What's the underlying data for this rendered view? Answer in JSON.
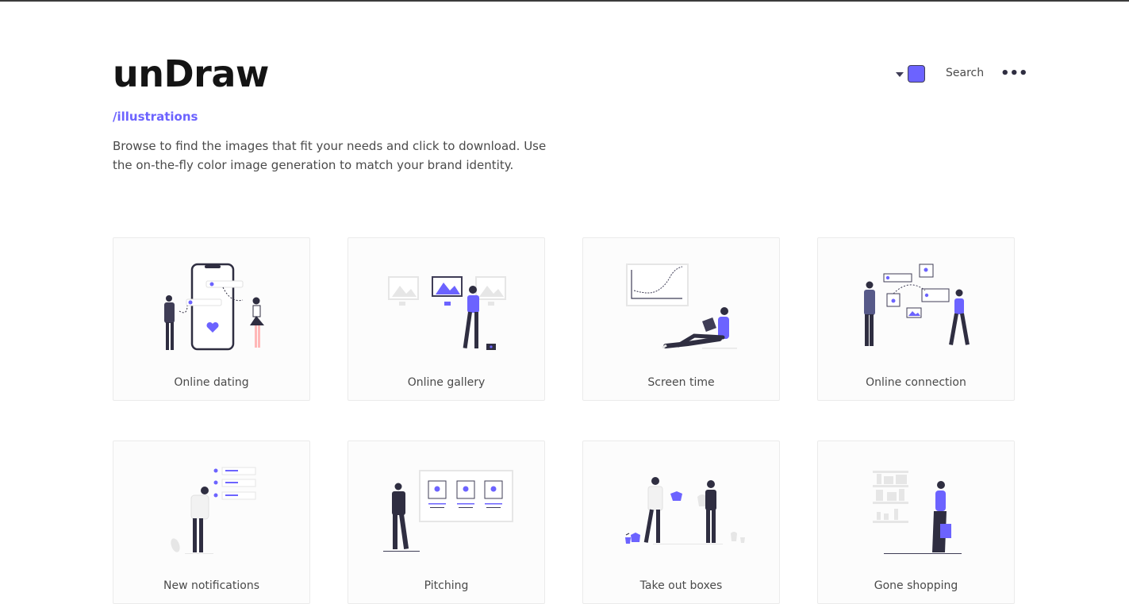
{
  "header": {
    "brand": "unDraw",
    "section": "/illustrations",
    "description": "Browse to find the images that fit your needs and click to download. Use the on-the-fly color image generation to match your brand identity.",
    "search_label": "Search",
    "more_label": "•••",
    "accent_color": "#6c63ff"
  },
  "colors": {
    "accent": "#6c63ff",
    "dark": "#2f2e41",
    "light_gray": "#e6e6e6"
  },
  "cards": [
    {
      "label": "Online dating",
      "icon": "online-dating-illustration"
    },
    {
      "label": "Online gallery",
      "icon": "online-gallery-illustration"
    },
    {
      "label": "Screen time",
      "icon": "screen-time-illustration"
    },
    {
      "label": "Online connection",
      "icon": "online-connection-illustration"
    },
    {
      "label": "New notifications",
      "icon": "new-notifications-illustration"
    },
    {
      "label": "Pitching",
      "icon": "pitching-illustration"
    },
    {
      "label": "Take out boxes",
      "icon": "take-out-boxes-illustration"
    },
    {
      "label": "Gone shopping",
      "icon": "gone-shopping-illustration"
    }
  ]
}
